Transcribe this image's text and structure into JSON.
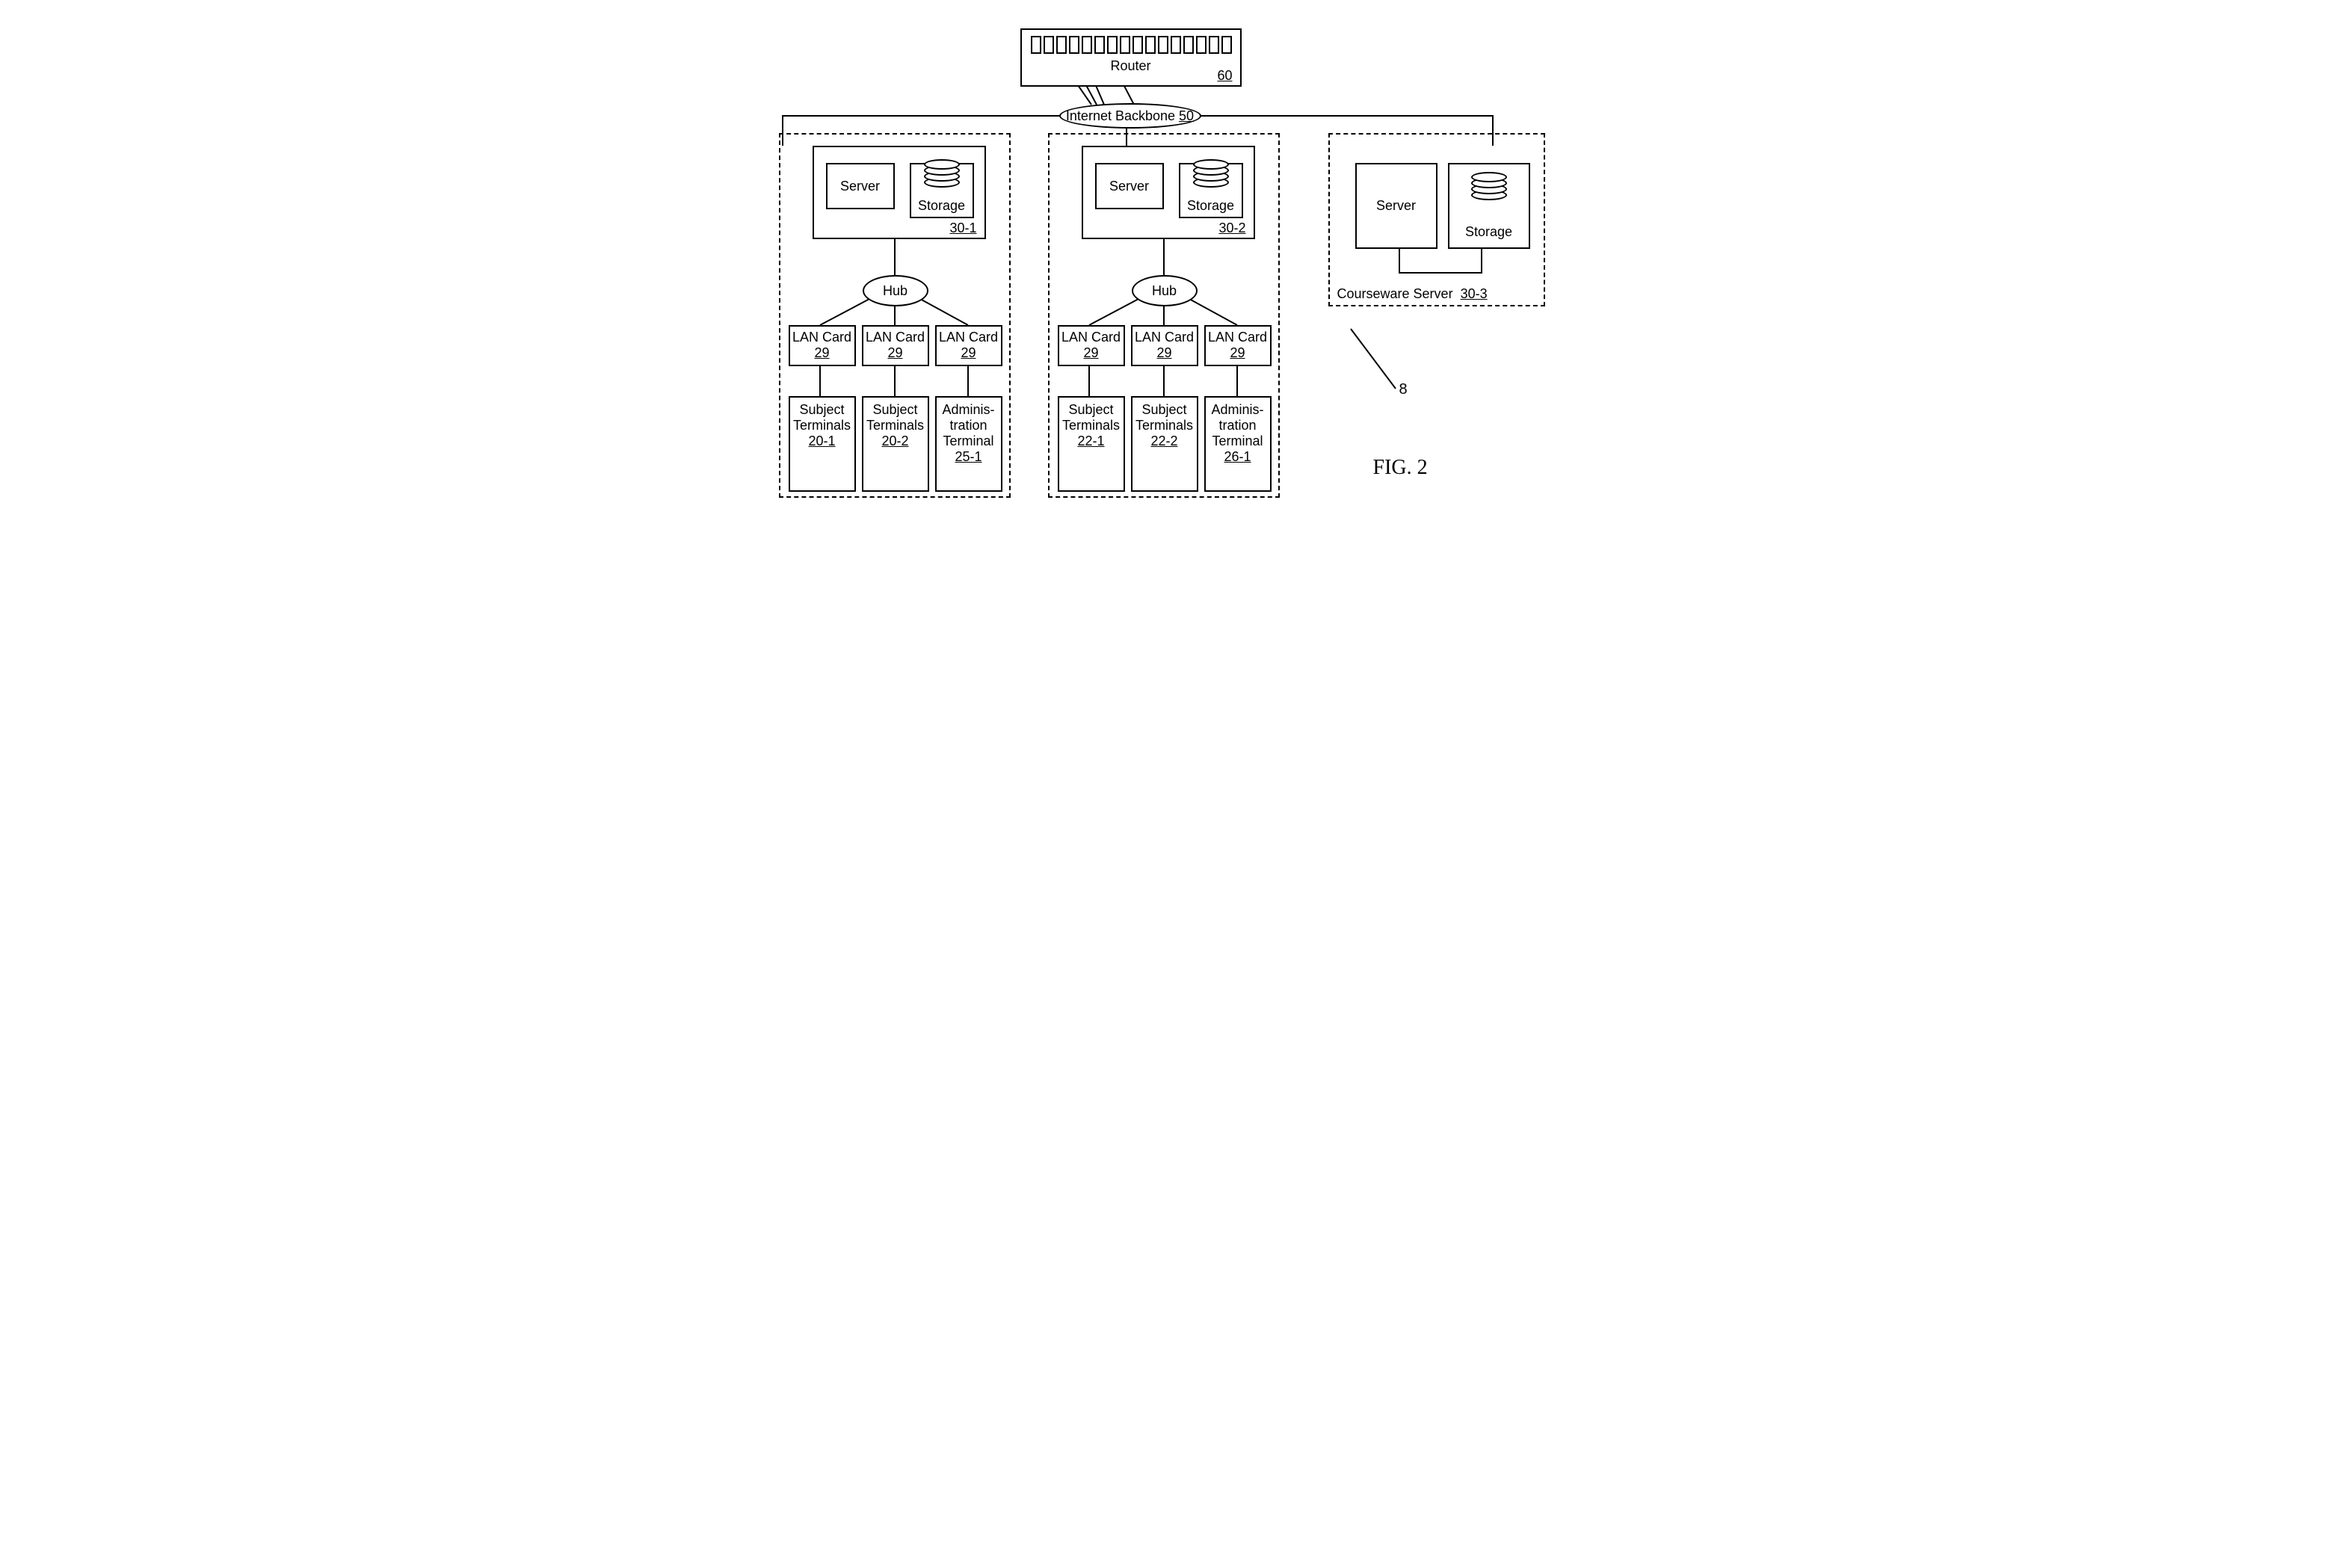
{
  "router": {
    "label": "Router",
    "ref": "60"
  },
  "backbone": {
    "label": "Internet Backbone",
    "ref": "50"
  },
  "hub": {
    "label": "Hub"
  },
  "server": {
    "label": "Server"
  },
  "storage": {
    "label": "Storage"
  },
  "lancard": {
    "label": "LAN Card",
    "ref": "29"
  },
  "refs": {
    "site1_server": "30-1",
    "site2_server": "30-2",
    "courseware": "Courseware Server",
    "courseware_ref": "30-3"
  },
  "terminals": {
    "subj1": "Subject Terminals",
    "admin": "Adminis-tration Terminal",
    "s1t1": "20-1",
    "s1t2": "20-2",
    "s1a": "25-1",
    "s2t1": "22-1",
    "s2t2": "22-2",
    "s2a": "26-1"
  },
  "callout": "8",
  "figure": "FIG. 2"
}
